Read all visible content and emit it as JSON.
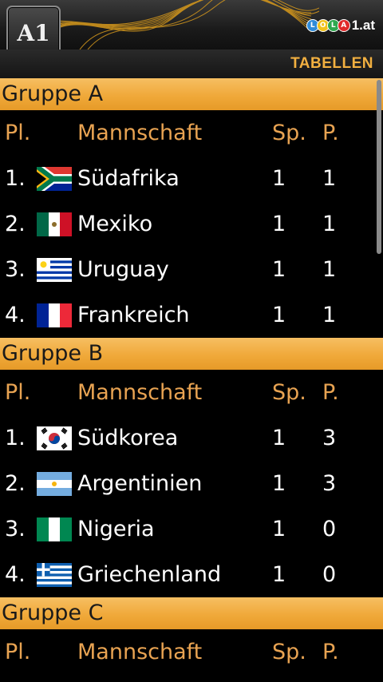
{
  "header": {
    "logo": "A1",
    "brand": {
      "balls": [
        {
          "letter": "L",
          "color": "#2f8bd8"
        },
        {
          "letter": "O",
          "color": "#f1c21b"
        },
        {
          "letter": "L",
          "color": "#2fa84f"
        },
        {
          "letter": "A",
          "color": "#e02a2a"
        }
      ],
      "text": "1.at"
    },
    "title": "TABELLEN"
  },
  "columns": {
    "pl": "Pl.",
    "team": "Mannschaft",
    "sp": "Sp.",
    "p": "P."
  },
  "groups": [
    {
      "name": "Gruppe A",
      "teams": [
        {
          "pos": "1.",
          "flag": "south-africa-flag",
          "name": "Südafrika",
          "sp": "1",
          "p": "1"
        },
        {
          "pos": "2.",
          "flag": "mexico-flag",
          "name": "Mexiko",
          "sp": "1",
          "p": "1"
        },
        {
          "pos": "3.",
          "flag": "uruguay-flag",
          "name": "Uruguay",
          "sp": "1",
          "p": "1"
        },
        {
          "pos": "4.",
          "flag": "france-flag",
          "name": "Frankreich",
          "sp": "1",
          "p": "1"
        }
      ]
    },
    {
      "name": "Gruppe B",
      "teams": [
        {
          "pos": "1.",
          "flag": "south-korea-flag",
          "name": "Südkorea",
          "sp": "1",
          "p": "3"
        },
        {
          "pos": "2.",
          "flag": "argentina-flag",
          "name": "Argentinien",
          "sp": "1",
          "p": "3"
        },
        {
          "pos": "3.",
          "flag": "nigeria-flag",
          "name": "Nigeria",
          "sp": "1",
          "p": "0"
        },
        {
          "pos": "4.",
          "flag": "greece-flag",
          "name": "Griechenland",
          "sp": "1",
          "p": "0"
        }
      ]
    },
    {
      "name": "Gruppe C",
      "teams": []
    }
  ],
  "colors": {
    "accent": "#f0a93a",
    "column_header": "#e8a352",
    "background": "#000000"
  }
}
